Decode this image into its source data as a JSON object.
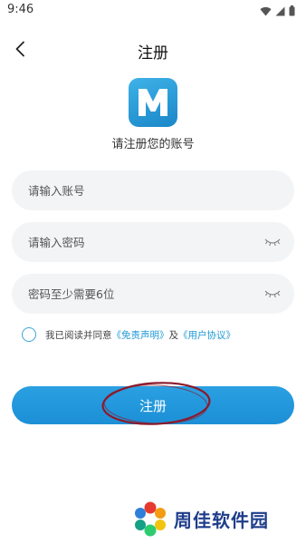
{
  "status_bar": {
    "time": "9:46",
    "icons": [
      "wifi-icon",
      "cellular-signal-icon",
      "battery-icon"
    ]
  },
  "nav": {
    "back_icon": "chevron-left-icon",
    "title": "注册"
  },
  "logo": {
    "letter": "M",
    "color": "#2a9ddc"
  },
  "subtitle": "请注册您的账号",
  "form": {
    "account": {
      "placeholder": "请输入账号",
      "value": ""
    },
    "password": {
      "placeholder": "请输入密码",
      "value": "",
      "icon": "eye-closed-icon"
    },
    "password_hint": {
      "placeholder": "密码至少需要6位",
      "value": "",
      "icon": "eye-closed-icon"
    }
  },
  "agreement": {
    "checked": false,
    "prefix": "我已阅读并同意",
    "disclaimer_link": "《免责声明》",
    "conjunction": "及",
    "user_agreement_link": "《用户协议》"
  },
  "submit_label": "注册",
  "watermark": {
    "text": "周佳软件园"
  },
  "colors": {
    "accent": "#1f9ad6",
    "button": "#229bdd",
    "input_bg": "#f3f4f6",
    "annotation": "#8b1a2b",
    "watermark_text": "#1e3d8a"
  }
}
